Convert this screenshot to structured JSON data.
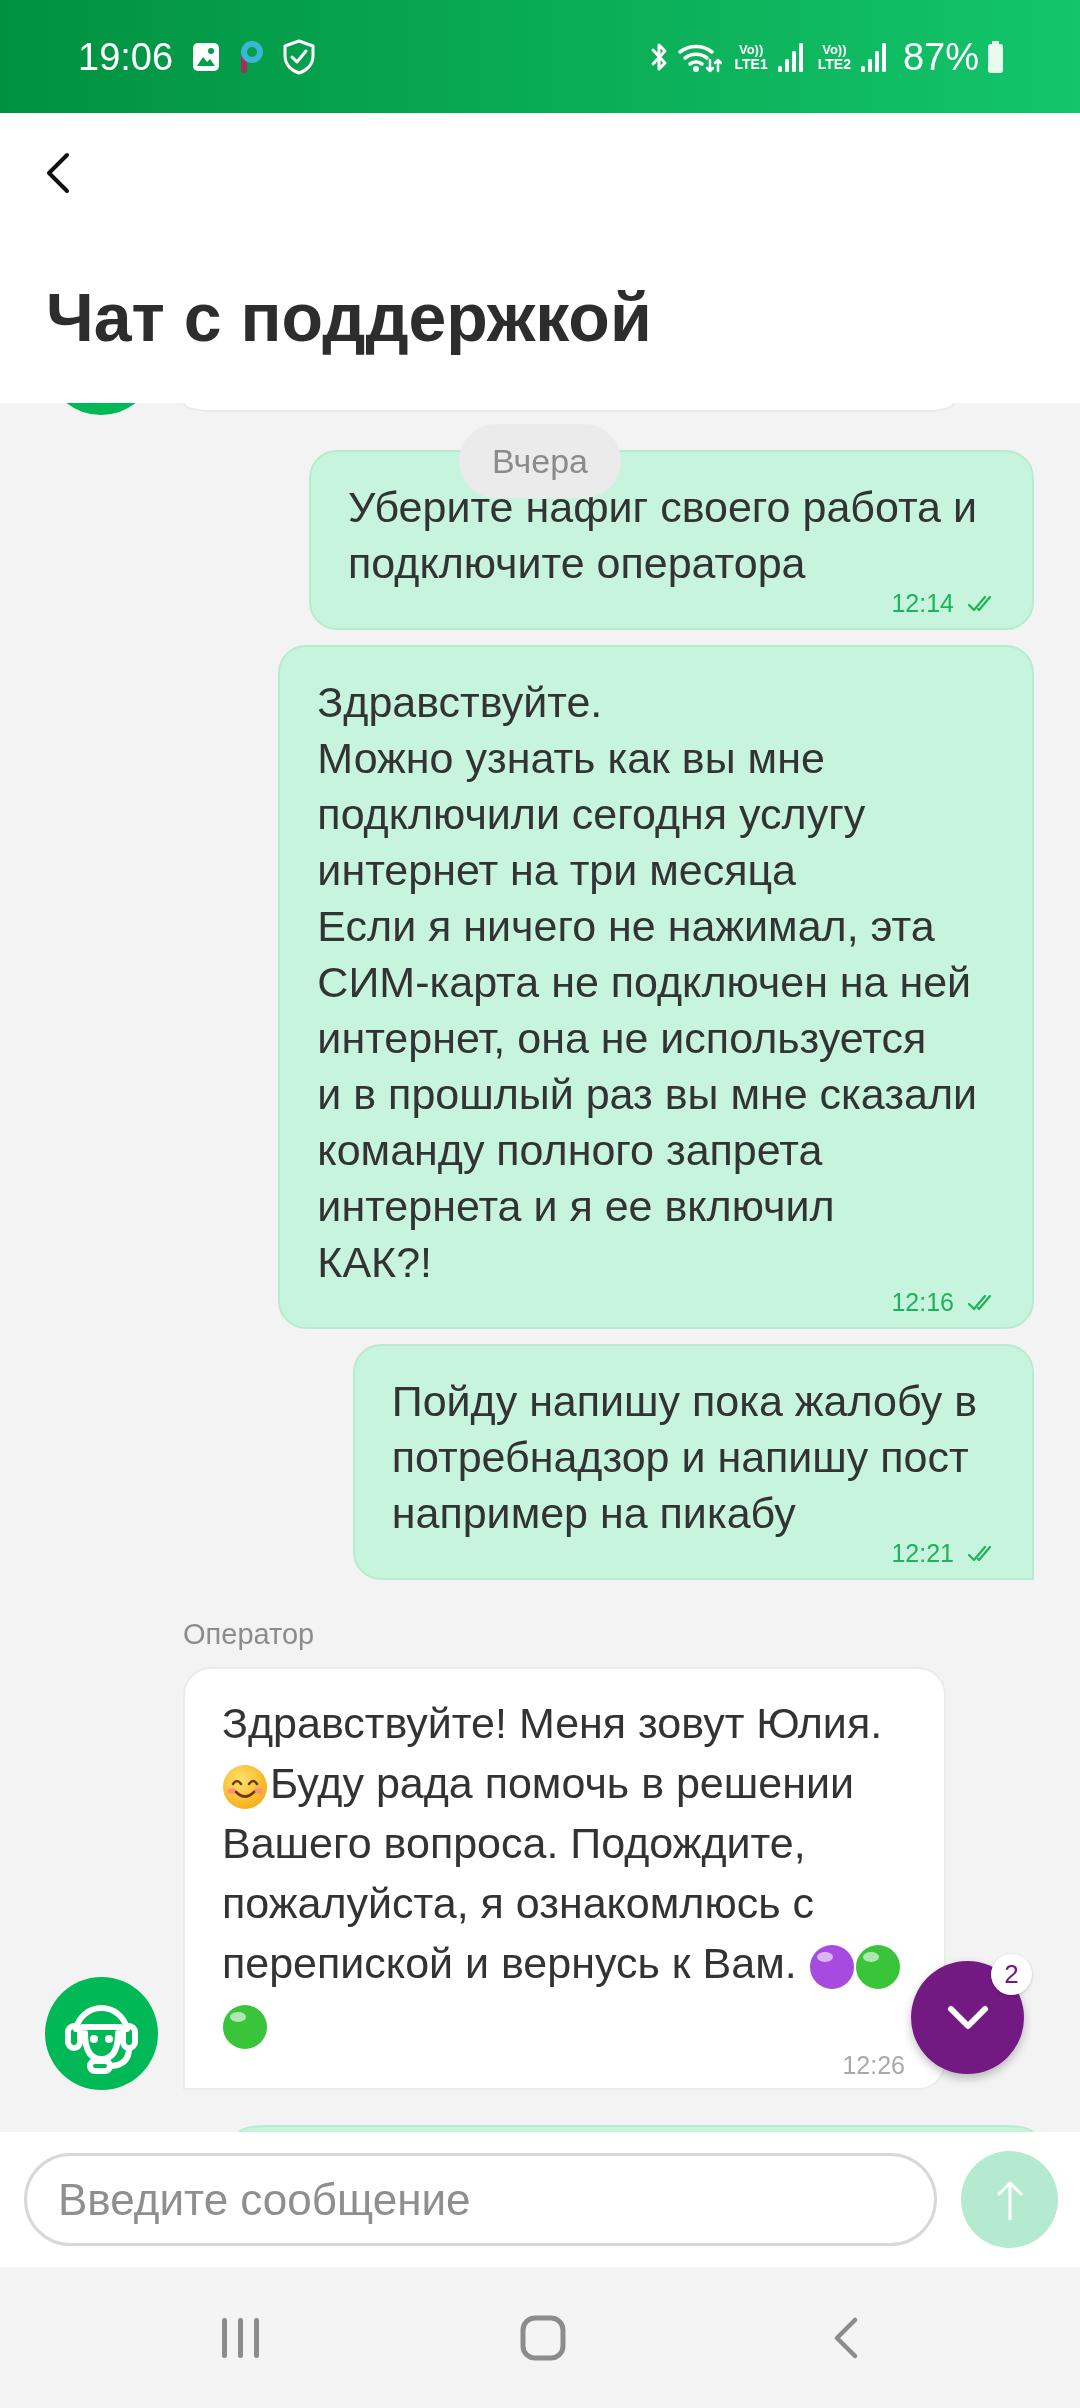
{
  "status_bar": {
    "time": "19:06",
    "sims": [
      {
        "tech": "Vo))",
        "label": "LTE1"
      },
      {
        "tech": "Vo))",
        "label": "LTE2"
      }
    ],
    "battery": "87%"
  },
  "header": {
    "title": "Чат с поддержкой"
  },
  "chat": {
    "date_label": "Вчера",
    "edge_above": {
      "kind": "operator"
    },
    "messages": [
      {
        "kind": "user",
        "text": "Уберите нафиг своего работа и\nподключите оператора",
        "time": "12:14",
        "read": true
      },
      {
        "kind": "user",
        "text": "Здравствуйте.\nМожно узнать как вы мне\nподключили сегодня услугу\nинтернет на три месяца\nЕсли я ничего не нажимал, эта\nСИМ-карта не подключен на ней\nинтернет, она не используется\nи в прошлый раз вы мне сказали\nкоманду полного запрета\nинтернета и я ее включил\nКАК?!",
        "time": "12:16",
        "read": true
      },
      {
        "kind": "user",
        "text": "Пойду напишу пока жалобу в\nпотребнадзор и напишу пост\nнапример на пикабу",
        "time": "12:21",
        "read": true
      },
      {
        "kind": "operator",
        "sender": "Оператор",
        "parts": [
          {
            "kind": "text",
            "text": "Здравствуйте! Меня зовут Юлия."
          },
          {
            "kind": "smiley"
          },
          {
            "kind": "text",
            "text": "Буду рада помочь в решении"
          },
          {
            "kind": "text",
            "text": "Вашего вопроса. Подождите, пожалуйста, я ознакомлюсь с перепиской и вернусь к Вам."
          },
          {
            "kind": "ball",
            "color": "#a64ae0"
          },
          {
            "kind": "ball",
            "color": "#39c43a"
          },
          {
            "kind": "ball",
            "color": "#39c43a"
          }
        ],
        "time": "12:26"
      }
    ],
    "edge_below": {
      "kind": "user"
    }
  },
  "scroll_button": {
    "badge": "2"
  },
  "composer": {
    "placeholder": "Введите сообщение",
    "send_button": {
      "disabled": true
    }
  }
}
